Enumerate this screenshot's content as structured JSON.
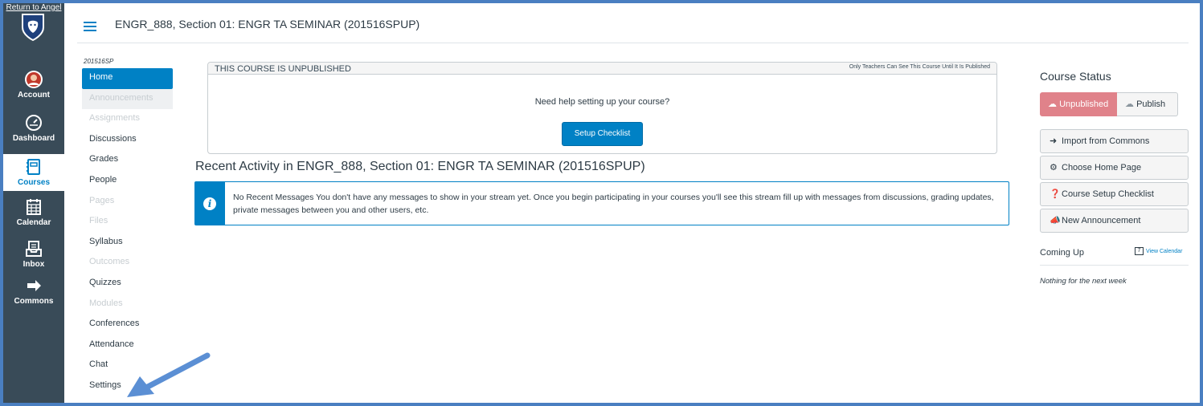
{
  "global_nav": {
    "return_link": "Return to Angel",
    "items": [
      {
        "label": "Account",
        "icon": "avatar"
      },
      {
        "label": "Dashboard",
        "icon": "dashboard-icon"
      },
      {
        "label": "Courses",
        "icon": "courses-icon"
      },
      {
        "label": "Calendar",
        "icon": "calendar-icon"
      },
      {
        "label": "Inbox",
        "icon": "inbox-icon"
      },
      {
        "label": "Commons",
        "icon": "commons-icon"
      }
    ]
  },
  "header": {
    "course_title": "ENGR_888, Section 01: ENGR TA SEMINAR (201516SPUP)"
  },
  "course_nav": {
    "term": "201516SP",
    "items": [
      {
        "label": "Home"
      },
      {
        "label": "Announcements"
      },
      {
        "label": "Assignments"
      },
      {
        "label": "Discussions"
      },
      {
        "label": "Grades"
      },
      {
        "label": "People"
      },
      {
        "label": "Pages"
      },
      {
        "label": "Files"
      },
      {
        "label": "Syllabus"
      },
      {
        "label": "Outcomes"
      },
      {
        "label": "Quizzes"
      },
      {
        "label": "Modules"
      },
      {
        "label": "Conferences"
      },
      {
        "label": "Attendance"
      },
      {
        "label": "Chat"
      },
      {
        "label": "Settings"
      }
    ]
  },
  "unpublished_box": {
    "title": "THIS COURSE IS UNPUBLISHED",
    "note": "Only Teachers Can See This Course Until It Is Published",
    "help_text": "Need help setting up your course?",
    "setup_button": "Setup Checklist"
  },
  "recent_activity": {
    "title": "Recent Activity in ENGR_888, Section 01: ENGR TA SEMINAR (201516SPUP)",
    "message": "No Recent Messages  You don't have any messages to show in your stream yet. Once you begin participating in your courses you'll see this stream fill up with messages from discussions, grading updates, private messages between you and other users, etc."
  },
  "sidebar": {
    "status_heading": "Course Status",
    "unpublished_label": "Unpublished",
    "publish_label": "Publish",
    "buttons": [
      {
        "label": "Import from Commons",
        "icon": "import-icon"
      },
      {
        "label": "Choose Home Page",
        "icon": "home-page-icon"
      },
      {
        "label": "Course Setup Checklist",
        "icon": "help-icon"
      },
      {
        "label": "New Announcement",
        "icon": "megaphone-icon"
      }
    ],
    "coming_up": "Coming Up",
    "view_calendar": "View Calendar",
    "nothing": "Nothing for the next week"
  },
  "colors": {
    "nav_bg": "#394b58",
    "accent": "#0081c5",
    "unpublished": "#e0828a",
    "frame": "#4a7fc1"
  }
}
